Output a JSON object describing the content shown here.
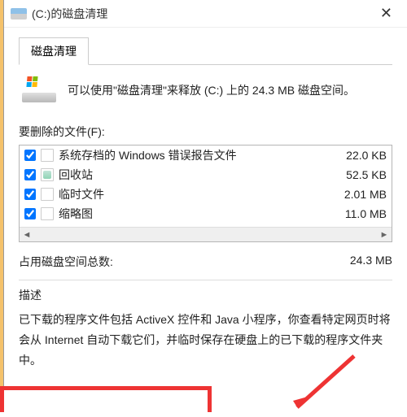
{
  "window": {
    "title": "(C:)的磁盘清理"
  },
  "tab": {
    "label": "磁盘清理"
  },
  "intro": "可以使用\"磁盘清理\"来释放  (C:) 上的 24.3 MB 磁盘空间。",
  "files_label": "要删除的文件(F):",
  "items": [
    {
      "name": "系统存档的 Windows 错误报告文件",
      "size": "22.0 KB",
      "checked": true,
      "icon": "file"
    },
    {
      "name": "回收站",
      "size": "52.5 KB",
      "checked": true,
      "icon": "recycle"
    },
    {
      "name": "临时文件",
      "size": "2.01 MB",
      "checked": true,
      "icon": "file"
    },
    {
      "name": "缩略图",
      "size": "11.0 MB",
      "checked": true,
      "icon": "file"
    }
  ],
  "totals": {
    "label": "占用磁盘空间总数:",
    "value": "24.3 MB"
  },
  "description": {
    "caption": "描述",
    "body": "已下载的程序文件包括 ActiveX 控件和 Java 小程序，你查看特定网页时将会从 Internet 自动下载它们，并临时保存在硬盘上的已下载的程序文件夹中。"
  }
}
